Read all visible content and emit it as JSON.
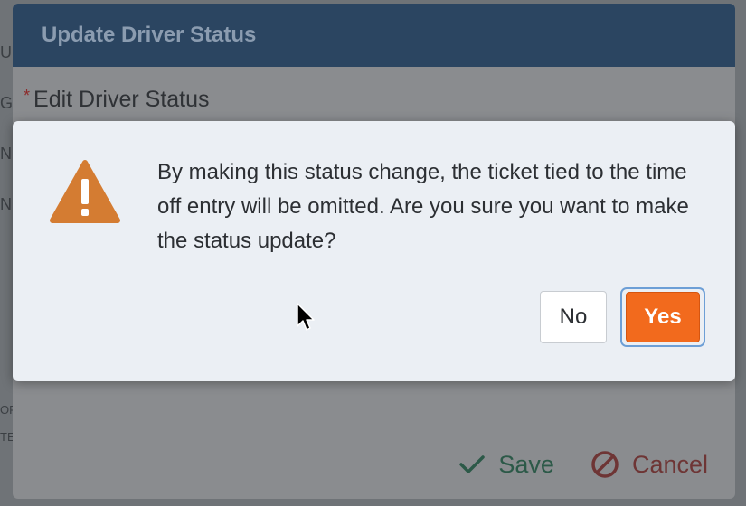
{
  "background": {
    "edge_fragments": [
      "U",
      "G",
      "N",
      "N",
      "OF",
      "TE"
    ]
  },
  "underlying_modal": {
    "title": "Update Driver Status",
    "field_label": "Edit Driver Status",
    "required_marker": "*",
    "save_label": "Save",
    "cancel_label": "Cancel"
  },
  "confirm_dialog": {
    "message": "By making this status change, the ticket tied to the time off entry will be omitted. Are you sure you want to make the status update?",
    "no_label": "No",
    "yes_label": "Yes"
  },
  "icons": {
    "warning": "warning-triangle-icon",
    "save": "checkmark-icon",
    "cancel": "no-entry-icon",
    "cursor": "mouse-pointer-icon"
  },
  "colors": {
    "warning": "#d47c32",
    "yes_button": "#f26a1d",
    "header_bg": "#2b4561",
    "save": "#2c5948",
    "cancel": "#6e3535",
    "focus_ring": "#6d9fd6"
  }
}
